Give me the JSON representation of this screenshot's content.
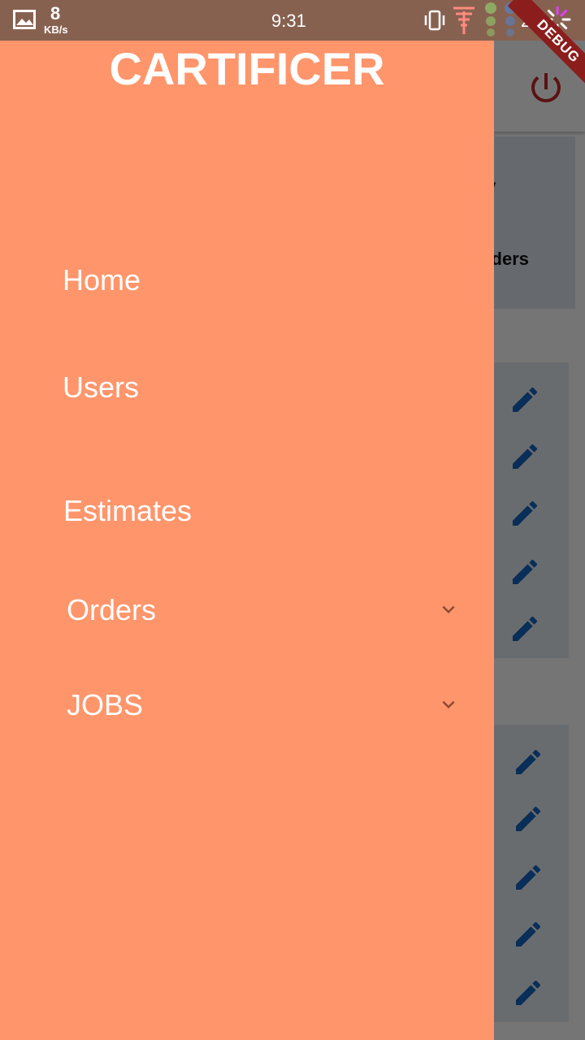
{
  "status_bar": {
    "speed_value": "8",
    "speed_unit": "KB/s",
    "time": "9:31",
    "battery": "22"
  },
  "debug_banner": "DEBUG",
  "drawer": {
    "title": "CARTIFICER",
    "items": [
      {
        "label": "Home",
        "expandable": false
      },
      {
        "label": "Users",
        "expandable": false
      },
      {
        "label": "Estimates",
        "expandable": false
      },
      {
        "label": "Orders",
        "expandable": true
      },
      {
        "label": "JOBS",
        "expandable": true
      }
    ]
  },
  "background": {
    "card_partial_text": "rders",
    "card_partial_top": "v"
  },
  "colors": {
    "drawer_bg": "#ff956b",
    "accent_blue": "#1565c0",
    "power_red": "#c62828"
  }
}
